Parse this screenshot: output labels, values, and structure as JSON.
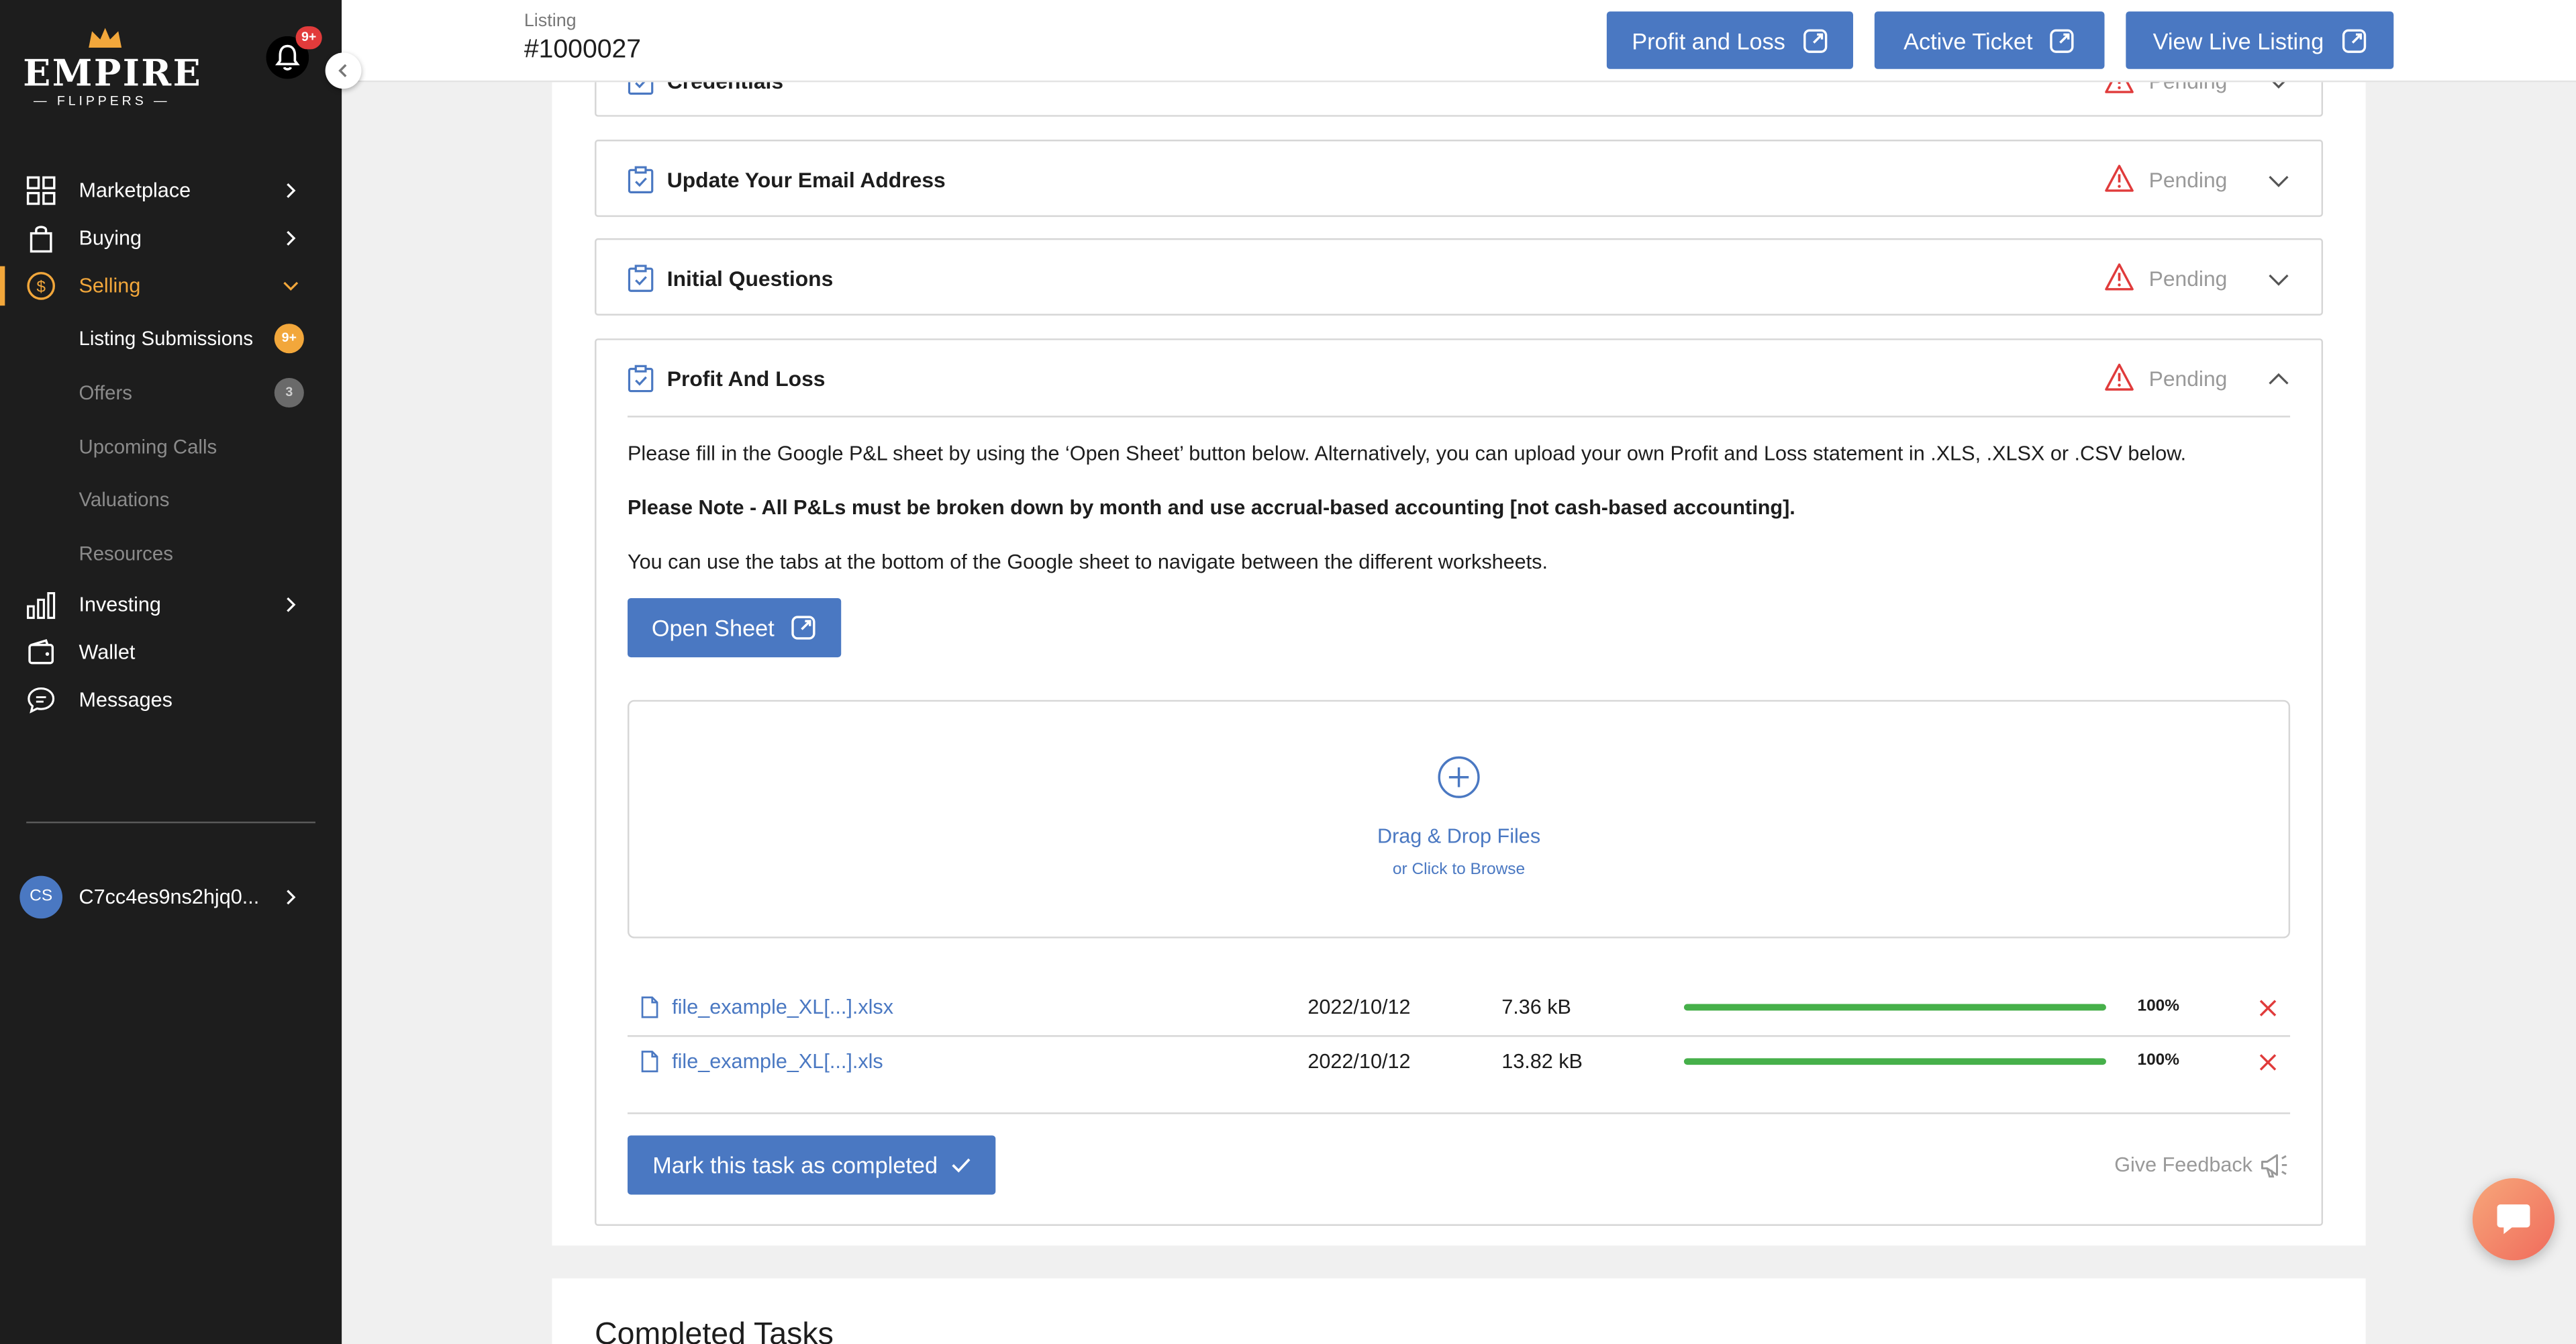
{
  "sidebar": {
    "logo_word": "EMPIRE",
    "logo_sub": "— FLIPPERS —",
    "notification_badge": "9+",
    "nav": [
      {
        "label": "Marketplace",
        "icon": "grid-icon"
      },
      {
        "label": "Buying",
        "icon": "shopping-bag-icon"
      },
      {
        "label": "Selling",
        "icon": "dollar-circle-icon"
      },
      {
        "label": "Investing",
        "icon": "bar-chart-icon"
      },
      {
        "label": "Wallet",
        "icon": "wallet-icon"
      },
      {
        "label": "Messages",
        "icon": "chat-bubble-icon"
      }
    ],
    "selling_sub": [
      {
        "label": "Listing Submissions",
        "badge": "9+"
      },
      {
        "label": "Offers",
        "badge": "3"
      },
      {
        "label": "Upcoming Calls"
      },
      {
        "label": "Valuations"
      },
      {
        "label": "Resources"
      }
    ],
    "user": {
      "initials": "CS",
      "name": "C7cc4es9ns2hjq0..."
    }
  },
  "header": {
    "crumb": "Listing",
    "listing_id": "#1000027",
    "buttons": [
      "Profit and Loss",
      "Active Ticket",
      "View Live Listing"
    ]
  },
  "tasks": [
    {
      "title": "Credentials",
      "status": "Pending"
    },
    {
      "title": "Update Your Email Address",
      "status": "Pending"
    },
    {
      "title": "Initial Questions",
      "status": "Pending"
    },
    {
      "title": "Profit And Loss",
      "status": "Pending"
    }
  ],
  "pnl": {
    "intro": "Please fill in the Google P&L sheet by using the ‘Open Sheet’ button below. Alternatively, you can upload your own Profit and Loss statement in .XLS, .XLSX or .CSV below.",
    "note": "Please Note - All P&Ls must be broken down by month and use accrual-based accounting [not cash-based accounting].",
    "tabs_hint": "You can use the tabs at the bottom of the Google sheet to navigate between the different worksheets.",
    "open_sheet": "Open Sheet",
    "dropzone_main": "Drag & Drop Files",
    "dropzone_sub": "or Click to Browse",
    "files": [
      {
        "name": "file_example_XL[...].xlsx",
        "date": "2022/10/12",
        "size": "7.36 kB",
        "progress": 100,
        "progress_label": "100%"
      },
      {
        "name": "file_example_XL[...].xls",
        "date": "2022/10/12",
        "size": "13.82 kB",
        "progress": 100,
        "progress_label": "100%"
      }
    ],
    "complete_button": "Mark this task as completed",
    "feedback": "Give Feedback"
  },
  "completed": {
    "title": "Completed Tasks"
  },
  "colors": {
    "accent": "#4a78c2",
    "brand_orange": "#f2a73b",
    "warning_red": "#e03b3b",
    "progress_green": "#46b04a",
    "sidebar_bg": "#1d1d1d"
  }
}
